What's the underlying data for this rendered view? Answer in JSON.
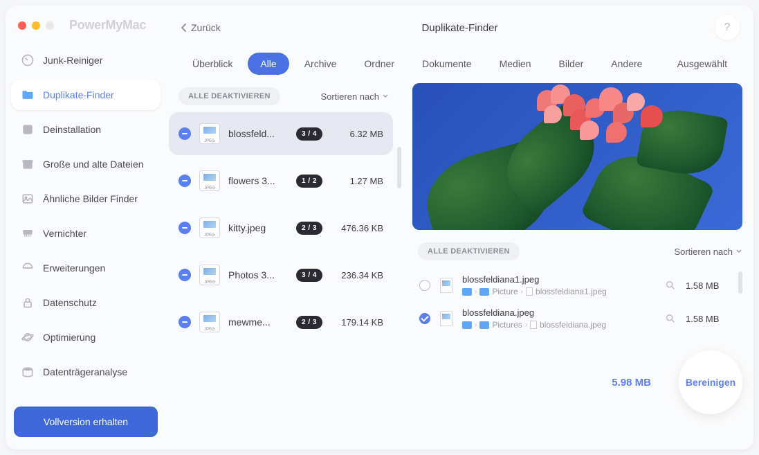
{
  "app_name": "PowerMyMac",
  "header": {
    "back_label": "Zurück",
    "title": "Duplikate-Finder",
    "help": "?"
  },
  "sidebar": {
    "items": [
      {
        "label": "Junk-Reiniger",
        "icon": "gauge-icon"
      },
      {
        "label": "Duplikate-Finder",
        "icon": "folder-icon",
        "active": true
      },
      {
        "label": "Deinstallation",
        "icon": "apps-icon"
      },
      {
        "label": "Große und alte Dateien",
        "icon": "archive-icon"
      },
      {
        "label": "Ähnliche Bilder Finder",
        "icon": "image-icon"
      },
      {
        "label": "Vernichter",
        "icon": "shredder-icon"
      },
      {
        "label": "Erweiterungen",
        "icon": "puzzle-icon"
      },
      {
        "label": "Datenschutz",
        "icon": "lock-icon"
      },
      {
        "label": "Optimierung",
        "icon": "planet-icon"
      },
      {
        "label": "Datenträgeranalyse",
        "icon": "disk-icon"
      }
    ],
    "full_version_label": "Vollversion erhalten"
  },
  "tabs": [
    {
      "label": "Überblick"
    },
    {
      "label": "Alle",
      "active": true
    },
    {
      "label": "Archive"
    },
    {
      "label": "Ordner"
    },
    {
      "label": "Dokumente"
    },
    {
      "label": "Medien"
    },
    {
      "label": "Bilder"
    },
    {
      "label": "Andere"
    },
    {
      "label": "Ausgewählt"
    }
  ],
  "left_panel": {
    "deactivate_label": "ALLE DEAKTIVIEREN",
    "sort_label": "Sortieren nach",
    "items": [
      {
        "name": "blossfeld...",
        "badge": "3 / 4",
        "size": "6.32 MB",
        "thumb_label": "JPEG",
        "selected": true
      },
      {
        "name": "flowers 3...",
        "badge": "1 / 2",
        "size": "1.27 MB",
        "thumb_label": "JPEG"
      },
      {
        "name": "kitty.jpeg",
        "badge": "2 / 3",
        "size": "476.36 KB",
        "thumb_label": "JPEG"
      },
      {
        "name": "Photos 3...",
        "badge": "3 / 4",
        "size": "236.34 KB",
        "thumb_label": "JPEG"
      },
      {
        "name": "mewme...",
        "badge": "2 / 3",
        "size": "179.14 KB",
        "thumb_label": "JPEG"
      }
    ]
  },
  "right_panel": {
    "deactivate_label": "ALLE DEAKTIVIEREN",
    "sort_label": "Sortieren nach",
    "items": [
      {
        "checked": false,
        "name": "blossfeldiana1.jpeg",
        "path_folder1": "",
        "path_folder2": "Picture",
        "path_file": "blossfeldiana1.jpeg",
        "size": "1.58 MB"
      },
      {
        "checked": true,
        "name": "blossfeldiana.jpeg",
        "path_folder1": "",
        "path_folder2": "Pictures",
        "path_file": "blossfeldiana.jpeg",
        "size": "1.58 MB"
      }
    ]
  },
  "footer": {
    "total_size": "5.98 MB",
    "clean_label": "Bereinigen"
  }
}
